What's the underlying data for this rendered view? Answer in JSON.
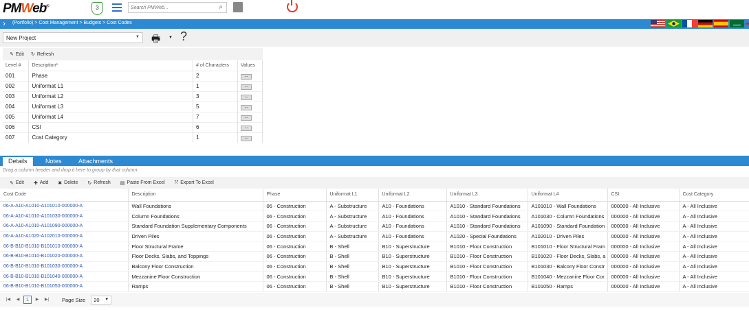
{
  "header": {
    "logo_text": "PMWeb",
    "badge_count": "3",
    "search_placeholder": "Search PMWeb..."
  },
  "breadcrumb": "(Portfolio) > Cost Management > Budgets > Cost Codes",
  "project": {
    "selected": "New Project"
  },
  "levels_toolbar": {
    "edit": "Edit",
    "refresh": "Refresh"
  },
  "levels": {
    "headers": [
      "Level #",
      "Description*",
      "# of Characters",
      "Values"
    ],
    "rows": [
      {
        "level": "001",
        "desc": "Phase",
        "chars": "2"
      },
      {
        "level": "002",
        "desc": "Uniformat L1",
        "chars": "1"
      },
      {
        "level": "003",
        "desc": "Uniformat L2",
        "chars": "3"
      },
      {
        "level": "004",
        "desc": "Uniformat L3",
        "chars": "5"
      },
      {
        "level": "005",
        "desc": "Uniformat L4",
        "chars": "7"
      },
      {
        "level": "006",
        "desc": "CSI",
        "chars": "6"
      },
      {
        "level": "007",
        "desc": "Cost Category",
        "chars": "1"
      }
    ],
    "values_button": "..."
  },
  "tabs": [
    "Details",
    "Notes",
    "Attachments"
  ],
  "drag_hint": "Drag a column header and drop it here to group by that column",
  "details_toolbar": {
    "edit": "Edit",
    "add": "Add",
    "delete": "Delete",
    "refresh": "Refresh",
    "paste": "Paste From Excel",
    "export": "Export To Excel"
  },
  "details": {
    "headers": [
      "Cost Code",
      "Description",
      "Phase",
      "Uniformat L1",
      "Uniformat L2",
      "Uniformat L3",
      "Uniformat L4",
      "CSI",
      "Cost Category"
    ],
    "rows": [
      [
        "06-A-A10-A1010-A101010-000000-A",
        "Wall Foundations",
        "06 - Construction",
        "A - Substructure",
        "A10 - Foundations",
        "A1010 - Standard Foundations",
        "A101010 - Wall Foundations",
        "000000 - All Inclusive",
        "A - All Inclusive"
      ],
      [
        "06-A-A10-A1010-A101030-000000-A",
        "Column Foundations",
        "06 - Construction",
        "A - Substructure",
        "A10 - Foundations",
        "A1010 - Standard Foundations",
        "A101030 - Column Foundations",
        "000000 - All Inclusive",
        "A - All Inclusive"
      ],
      [
        "06-A-A10-A1010-A101090-000000-A",
        "Standard Foundation Supplementary Components",
        "06 - Construction",
        "A - Substructure",
        "A10 - Foundations",
        "A1010 - Standard Foundations",
        "A101090 - Standard Foundation",
        "000000 - All Inclusive",
        "A - All Inclusive"
      ],
      [
        "06-A-A10-A1020-A102010-000000-A",
        "Driven Piles",
        "06 - Construction",
        "A - Substructure",
        "A10 - Foundations",
        "A1020 - Special Foundations",
        "A102010 - Driven Piles",
        "000000 - All Inclusive",
        "A - All Inclusive"
      ],
      [
        "06-B-B10-B1010-B101010-000000-A",
        "Floor Structural Frame",
        "06 - Construction",
        "B - Shell",
        "B10 - Superstructure",
        "B1010 - Floor Construction",
        "B101010 - Floor Structural Fram",
        "000000 - All Inclusive",
        "A - All Inclusive"
      ],
      [
        "06-B-B10-B1010-B101020-000000-A",
        "Floor Decks, Slabs, and Toppings",
        "06 - Construction",
        "B - Shell",
        "B10 - Superstructure",
        "B1010 - Floor Construction",
        "B101020 - Floor Decks, Slabs, a",
        "000000 - All Inclusive",
        "A - All Inclusive"
      ],
      [
        "06-B-B10-B1010-B101030-000000-A",
        "Balcony Floor Construction",
        "06 - Construction",
        "B - Shell",
        "B10 - Superstructure",
        "B1010 - Floor Construction",
        "B101030 - Balcony Floor Constr",
        "000000 - All Inclusive",
        "A - All Inclusive"
      ],
      [
        "06-B-B10-B1010-B101040-000000-A",
        "Mezzanine Floor Construction",
        "06 - Construction",
        "B - Shell",
        "B10 - Superstructure",
        "B1010 - Floor Construction",
        "B101040 - Mezzanine Floor Cor",
        "000000 - All Inclusive",
        "A - All Inclusive"
      ],
      [
        "06-B-B10-B1010-B101050-000000-A",
        "Ramps",
        "06 - Construction",
        "B - Shell",
        "B10 - Superstructure",
        "B1010 - Floor Construction",
        "B101050 - Ramps",
        "000000 - All Inclusive",
        "A - All Inclusive"
      ]
    ]
  },
  "pager": {
    "current_page": "1",
    "page_size_label": "Page Size",
    "page_size": "20"
  }
}
